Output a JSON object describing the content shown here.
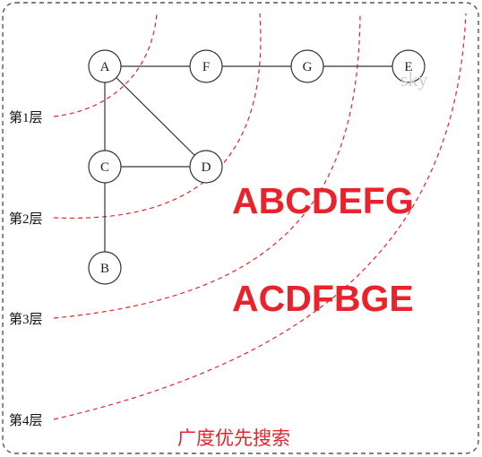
{
  "diagram": {
    "nodes": [
      {
        "id": "A",
        "label": "A"
      },
      {
        "id": "F",
        "label": "F"
      },
      {
        "id": "G",
        "label": "G"
      },
      {
        "id": "E",
        "label": "E"
      },
      {
        "id": "C",
        "label": "C"
      },
      {
        "id": "D",
        "label": "D"
      },
      {
        "id": "B",
        "label": "B"
      }
    ],
    "edges": [
      [
        "A",
        "F"
      ],
      [
        "F",
        "G"
      ],
      [
        "G",
        "E"
      ],
      [
        "A",
        "C"
      ],
      [
        "A",
        "D"
      ],
      [
        "C",
        "D"
      ],
      [
        "C",
        "B"
      ]
    ],
    "layers": [
      "第1层",
      "第2层",
      "第3层",
      "第4层"
    ],
    "results": [
      "ABCDEFG",
      "ACDFBGE"
    ],
    "caption": "广度优先搜索",
    "watermark": "sky",
    "colors": {
      "line": "#333333",
      "dashed_arc": "#e8232b",
      "text_highlight": "#e8232b",
      "border": "#555555"
    }
  }
}
